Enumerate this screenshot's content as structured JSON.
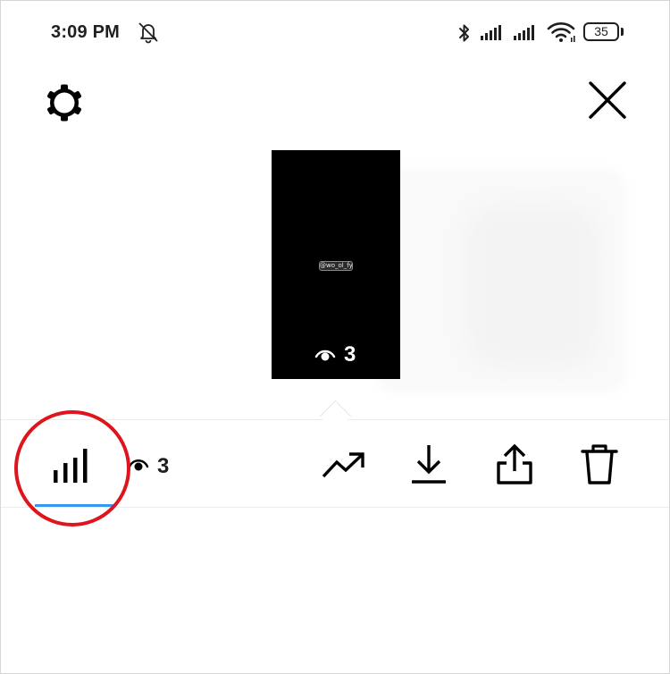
{
  "status_bar": {
    "time": "3:09 PM",
    "battery": "35"
  },
  "story_preview": {
    "mention_sticker": "@wo_ol_fy",
    "views": "3"
  },
  "toolbar": {
    "views_count": "3"
  },
  "colors": {
    "tab_indicator": "#3897f0",
    "highlight_circle": "#e0141c"
  }
}
